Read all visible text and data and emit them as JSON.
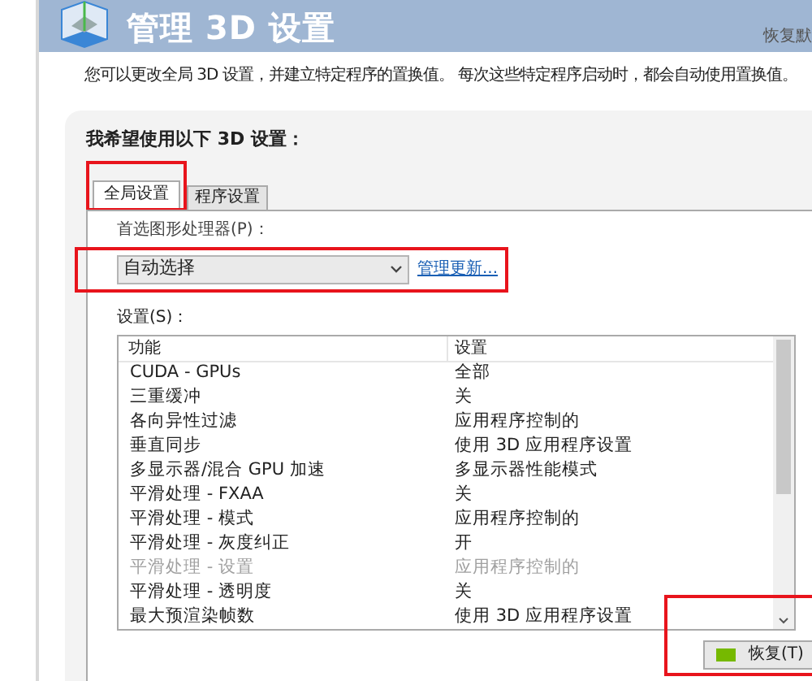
{
  "header": {
    "title": "管理 3D 设置",
    "restore_link": "恢复默"
  },
  "description": "您可以更改全局 3D 设置，并建立特定程序的置换值。 每次这些特定程序启动时，都会自动使用置换值。",
  "panel": {
    "heading": "我希望使用以下 3D 设置：",
    "tabs": [
      {
        "label": "全局设置",
        "selected": true
      },
      {
        "label": "程序设置",
        "selected": false
      }
    ],
    "gpu_label": "首选图形处理器(P)：",
    "gpu_select": {
      "value": "自动选择"
    },
    "manage_link": "管理更新...",
    "settings_label": "设置(S)：",
    "table": {
      "columns": [
        "功能",
        "设置"
      ],
      "rows": [
        {
          "feature": "CUDA - GPUs",
          "setting": "全部",
          "disabled": false
        },
        {
          "feature": "三重缓冲",
          "setting": "关",
          "disabled": false
        },
        {
          "feature": "各向异性过滤",
          "setting": "应用程序控制的",
          "disabled": false
        },
        {
          "feature": "垂直同步",
          "setting": "使用 3D 应用程序设置",
          "disabled": false
        },
        {
          "feature": "多显示器/混合 GPU 加速",
          "setting": "多显示器性能模式",
          "disabled": false
        },
        {
          "feature": "平滑处理 - FXAA",
          "setting": "关",
          "disabled": false
        },
        {
          "feature": "平滑处理 - 模式",
          "setting": "应用程序控制的",
          "disabled": false
        },
        {
          "feature": "平滑处理 - 灰度纠正",
          "setting": "开",
          "disabled": false
        },
        {
          "feature": "平滑处理 - 设置",
          "setting": "应用程序控制的",
          "disabled": true
        },
        {
          "feature": "平滑处理 - 透明度",
          "setting": "关",
          "disabled": false
        },
        {
          "feature": "最大预渲染帧数",
          "setting": "使用 3D 应用程序设置",
          "disabled": false
        }
      ]
    },
    "restore_button": "恢复(T)"
  }
}
